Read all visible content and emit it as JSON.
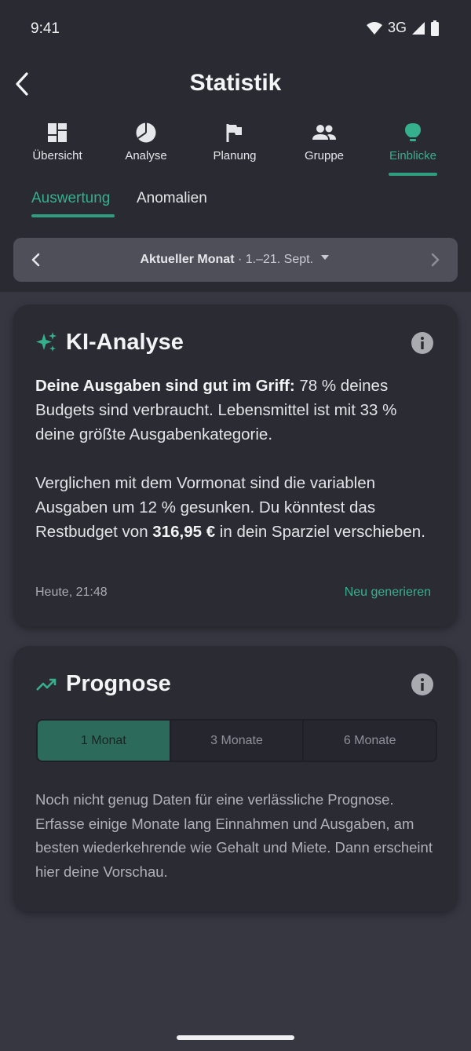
{
  "status_bar": {
    "time": "9:41",
    "network": "3G"
  },
  "header": {
    "title": "Statistik"
  },
  "main_tabs": [
    {
      "label": "Übersicht",
      "icon": "dashboard-icon"
    },
    {
      "label": "Analyse",
      "icon": "pie-chart-icon"
    },
    {
      "label": "Planung",
      "icon": "flag-icon"
    },
    {
      "label": "Gruppe",
      "icon": "group-icon"
    },
    {
      "label": "Einblicke",
      "icon": "lightbulb-icon",
      "active": true
    }
  ],
  "sub_tabs": [
    {
      "label": "Auswertung",
      "active": true
    },
    {
      "label": "Anomalien"
    }
  ],
  "period": {
    "label": "Aktueller Monat",
    "range": "· 1.–21. Sept."
  },
  "ai_card": {
    "title": "KI-Analyse",
    "p1_bold": "Deine Ausgaben sind gut im Griff:",
    "p1_rest": " 78 % deines Budgets sind verbraucht. Lebensmittel ist mit 33 % deine größte Ausgabenkategorie.",
    "p2_a": "Verglichen mit dem Vormonat sind die variablen Ausgaben um 12 % gesunken. Du könntest das Restbudget von ",
    "p2_amount": "316,95 €",
    "p2_b": " in dein Sparziel verschieben.",
    "timestamp": "Heute, 21:48",
    "regenerate": "Neu generieren"
  },
  "forecast_card": {
    "title": "Prognose",
    "options": [
      "1 Monat",
      "3 Monate",
      "6 Monate"
    ],
    "selected_index": 0,
    "message": "Noch nicht genug Daten für eine verlässliche Prognose. Erfasse einige Monate lang Einnahmen und Ausgaben, am besten wiederkehrende wie Gehalt und Miete. Dann erscheint hier deine Vorschau."
  },
  "colors": {
    "accent": "#36B08C",
    "background": "#363741",
    "card": "#2B2C33",
    "header": "#2A2B32"
  }
}
